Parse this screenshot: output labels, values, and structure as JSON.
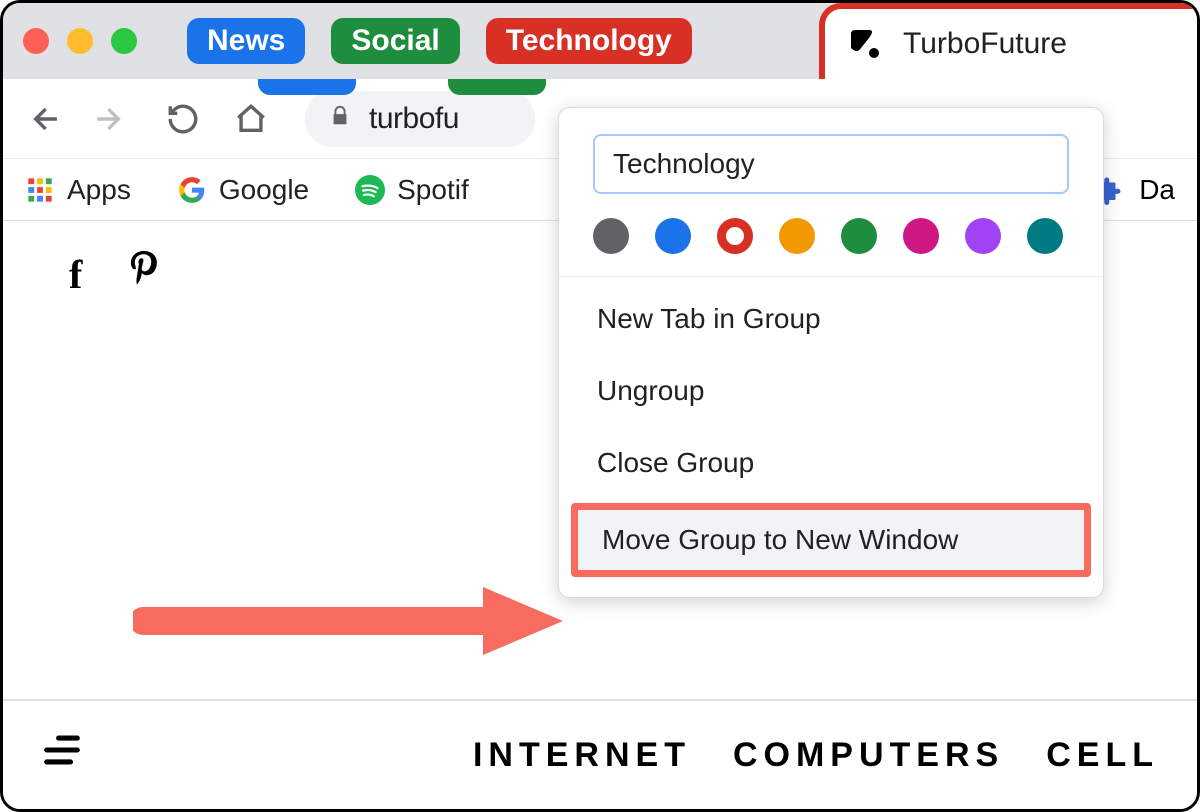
{
  "traffic_lights": [
    "close",
    "minimize",
    "maximize"
  ],
  "tab_groups": [
    {
      "label": "News",
      "color": "#1a73e8"
    },
    {
      "label": "Social",
      "color": "#1e8e3e"
    },
    {
      "label": "Technology",
      "color": "#d93025"
    }
  ],
  "active_tab": {
    "title": "TurboFuture",
    "favicon": "turbofuture"
  },
  "toolbar": {
    "address_display": "turbofu",
    "nav": {
      "back": true,
      "forward": false,
      "reload": true,
      "home": true
    }
  },
  "bookmarks": [
    {
      "icon": "apps",
      "label": "Apps"
    },
    {
      "icon": "google",
      "label": "Google"
    },
    {
      "icon": "spotify",
      "label": "Spotif"
    }
  ],
  "bookmarks_right": {
    "icon": "extension-puzzle",
    "label_partial": "Da"
  },
  "popover": {
    "group_name_value": "Technology",
    "colors": [
      {
        "name": "grey",
        "hex": "#5f6368",
        "selected": false
      },
      {
        "name": "blue",
        "hex": "#1a73e8",
        "selected": false
      },
      {
        "name": "red",
        "hex": "#d93025",
        "selected": true
      },
      {
        "name": "orange",
        "hex": "#f29900",
        "selected": false
      },
      {
        "name": "green",
        "hex": "#1e8e3e",
        "selected": false
      },
      {
        "name": "pink",
        "hex": "#d01884",
        "selected": false
      },
      {
        "name": "purple",
        "hex": "#a142f4",
        "selected": false
      },
      {
        "name": "cyan",
        "hex": "#007b83",
        "selected": false
      }
    ],
    "menu": {
      "new_tab": "New Tab in Group",
      "ungroup": "Ungroup",
      "close": "Close Group",
      "move": "Move Group to New Window"
    }
  },
  "content": {
    "social": {
      "facebook": "f",
      "pinterest": "p"
    },
    "nav_items": [
      "INTERNET",
      "COMPUTERS",
      "CELL"
    ]
  },
  "annotations": {
    "arrow_color": "#f76c5e"
  }
}
